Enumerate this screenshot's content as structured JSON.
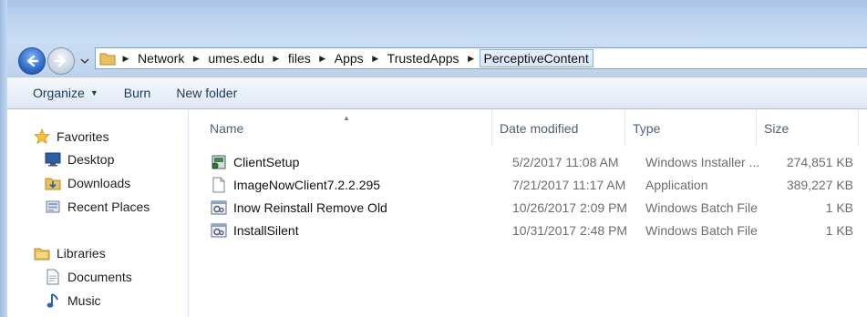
{
  "address": {
    "crumbs": [
      "Network",
      "umes.edu",
      "files",
      "Apps",
      "TrustedApps",
      "PerceptiveContent"
    ]
  },
  "toolbar": {
    "organize_label": "Organize",
    "burn_label": "Burn",
    "new_folder_label": "New folder"
  },
  "nav": {
    "favorites_label": "Favorites",
    "favorites_items": [
      "Desktop",
      "Downloads",
      "Recent Places"
    ],
    "libraries_label": "Libraries",
    "libraries_items": [
      "Documents",
      "Music"
    ]
  },
  "columns": {
    "name": "Name",
    "date": "Date modified",
    "type": "Type",
    "size": "Size"
  },
  "files": [
    {
      "name": "ClientSetup",
      "date": "5/2/2017 11:08 AM",
      "type": "Windows Installer ...",
      "size": "274,851 KB",
      "icon": "installer-icon"
    },
    {
      "name": "ImageNowClient7.2.2.295",
      "date": "7/21/2017 11:17 AM",
      "type": "Application",
      "size": "389,227 KB",
      "icon": "application-icon"
    },
    {
      "name": "Inow Reinstall Remove Old",
      "date": "10/26/2017 2:09 PM",
      "type": "Windows Batch File",
      "size": "1 KB",
      "icon": "batch-file-icon"
    },
    {
      "name": "InstallSilent",
      "date": "10/31/2017 2:48 PM",
      "type": "Windows Batch File",
      "size": "1 KB",
      "icon": "batch-file-icon"
    }
  ],
  "colors": {
    "title_gradient_top": "#a9c4e6",
    "toolbar_text": "#1e395b",
    "header_text": "#4c607a",
    "detail_text": "#6d6d6d"
  }
}
